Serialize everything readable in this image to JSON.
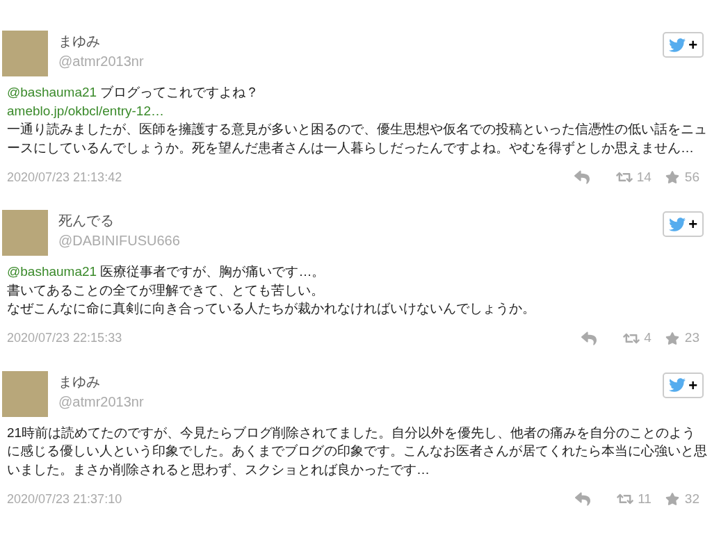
{
  "tweets": [
    {
      "name": "まゆみ",
      "handle": "@atmr2013nr",
      "follow_label": "+",
      "paragraphs": [
        [
          {
            "kind": "mention",
            "text": "@bashauma21"
          },
          {
            "kind": "text",
            "text": " ブログってこれですよね？"
          }
        ],
        [
          {
            "kind": "link",
            "text": "ameblo.jp/okbcl/entry-12…"
          }
        ],
        [
          {
            "kind": "text",
            "text": "一通り読みましたが、医師を擁護する意見が多いと困るので、優生思想や仮名での投稿といった信憑性の低い話をニュースにしているんでしょうか。死を望んだ患者さんは一人暮らしだったんですよね。やむを得ずとしか思えません…"
          }
        ]
      ],
      "time": "2020/07/23 21:13:42",
      "retweets": "14",
      "likes": "56"
    },
    {
      "name": "死んでる",
      "handle": "@DABINIFUSU666",
      "follow_label": "+",
      "paragraphs": [
        [
          {
            "kind": "mention",
            "text": "@bashauma21"
          },
          {
            "kind": "text",
            "text": " 医療従事者ですが、胸が痛いです…。"
          }
        ],
        [
          {
            "kind": "text",
            "text": "書いてあることの全てが理解できて、とても苦しい。"
          }
        ],
        [
          {
            "kind": "text",
            "text": "なぜこんなに命に真剣に向き合っている人たちが裁かれなければいけないんでしょうか。"
          }
        ]
      ],
      "time": "2020/07/23 22:15:33",
      "retweets": "4",
      "likes": "23"
    },
    {
      "name": "まゆみ",
      "handle": "@atmr2013nr",
      "follow_label": "+",
      "paragraphs": [
        [
          {
            "kind": "text",
            "text": "21時前は読めてたのですが、今見たらブログ削除されてました。自分以外を優先し、他者の痛みを自分のことのように感じる優しい人という印象でした。あくまでブログの印象です。こんなお医者さんが居てくれたら本当に心強いと思いました。まさか削除されると思わず、スクショとれば良かったです…"
          }
        ]
      ],
      "time": "2020/07/23 21:37:10",
      "retweets": "11",
      "likes": "32"
    }
  ]
}
